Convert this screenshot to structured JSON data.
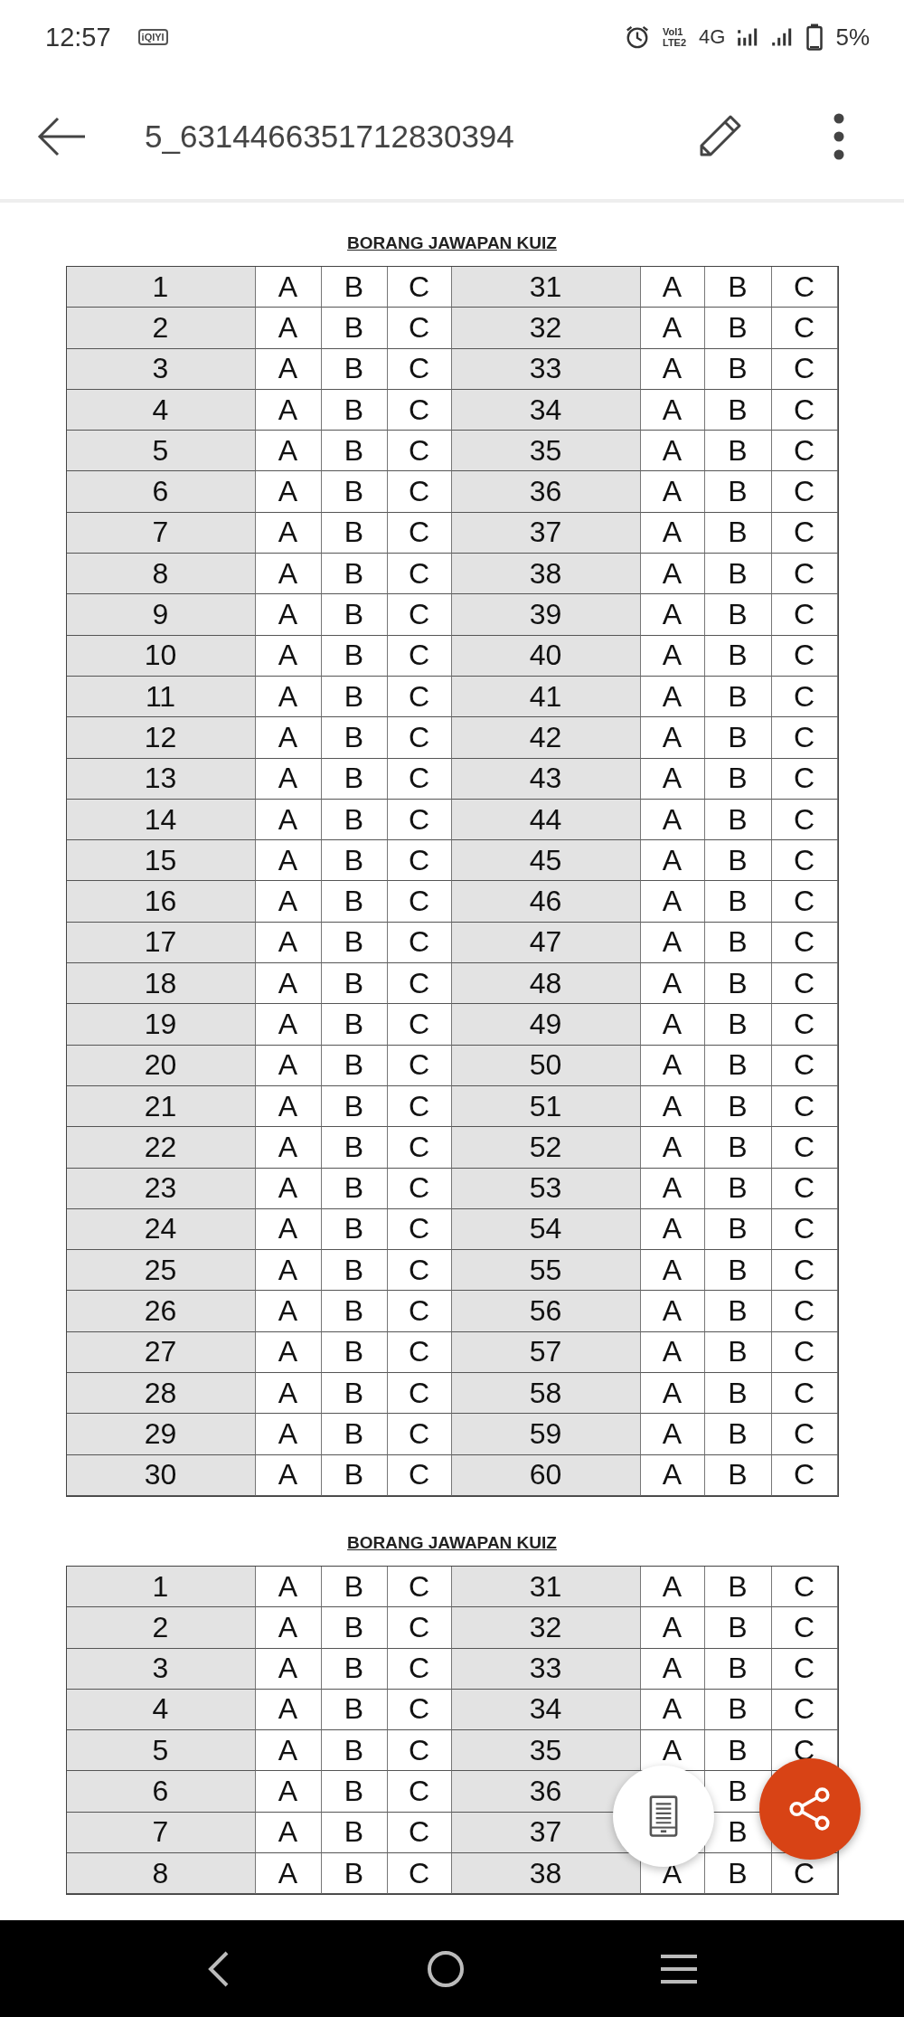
{
  "status_bar": {
    "time": "12:57",
    "app_badge": "iQIYI",
    "volte": [
      "Vol1",
      "LTE2"
    ],
    "network": "4G",
    "battery": "5%"
  },
  "app_bar": {
    "title": "5_6314466351712830394"
  },
  "sheets": [
    {
      "heading": "BORANG JAWAPAN KUIZ",
      "rows": [
        {
          "left": {
            "number": "1",
            "options": [
              "A",
              "B",
              "C"
            ]
          },
          "right": {
            "number": "31",
            "options": [
              "A",
              "B",
              "C"
            ]
          }
        },
        {
          "left": {
            "number": "2",
            "options": [
              "A",
              "B",
              "C"
            ]
          },
          "right": {
            "number": "32",
            "options": [
              "A",
              "B",
              "C"
            ]
          }
        },
        {
          "left": {
            "number": "3",
            "options": [
              "A",
              "B",
              "C"
            ]
          },
          "right": {
            "number": "33",
            "options": [
              "A",
              "B",
              "C"
            ]
          }
        },
        {
          "left": {
            "number": "4",
            "options": [
              "A",
              "B",
              "C"
            ]
          },
          "right": {
            "number": "34",
            "options": [
              "A",
              "B",
              "C"
            ]
          }
        },
        {
          "left": {
            "number": "5",
            "options": [
              "A",
              "B",
              "C"
            ]
          },
          "right": {
            "number": "35",
            "options": [
              "A",
              "B",
              "C"
            ]
          }
        },
        {
          "left": {
            "number": "6",
            "options": [
              "A",
              "B",
              "C"
            ]
          },
          "right": {
            "number": "36",
            "options": [
              "A",
              "B",
              "C"
            ]
          }
        },
        {
          "left": {
            "number": "7",
            "options": [
              "A",
              "B",
              "C"
            ]
          },
          "right": {
            "number": "37",
            "options": [
              "A",
              "B",
              "C"
            ]
          }
        },
        {
          "left": {
            "number": "8",
            "options": [
              "A",
              "B",
              "C"
            ]
          },
          "right": {
            "number": "38",
            "options": [
              "A",
              "B",
              "C"
            ]
          }
        },
        {
          "left": {
            "number": "9",
            "options": [
              "A",
              "B",
              "C"
            ]
          },
          "right": {
            "number": "39",
            "options": [
              "A",
              "B",
              "C"
            ]
          }
        },
        {
          "left": {
            "number": "10",
            "options": [
              "A",
              "B",
              "C"
            ]
          },
          "right": {
            "number": "40",
            "options": [
              "A",
              "B",
              "C"
            ]
          }
        },
        {
          "left": {
            "number": "11",
            "options": [
              "A",
              "B",
              "C"
            ]
          },
          "right": {
            "number": "41",
            "options": [
              "A",
              "B",
              "C"
            ]
          }
        },
        {
          "left": {
            "number": "12",
            "options": [
              "A",
              "B",
              "C"
            ]
          },
          "right": {
            "number": "42",
            "options": [
              "A",
              "B",
              "C"
            ]
          }
        },
        {
          "left": {
            "number": "13",
            "options": [
              "A",
              "B",
              "C"
            ]
          },
          "right": {
            "number": "43",
            "options": [
              "A",
              "B",
              "C"
            ]
          }
        },
        {
          "left": {
            "number": "14",
            "options": [
              "A",
              "B",
              "C"
            ]
          },
          "right": {
            "number": "44",
            "options": [
              "A",
              "B",
              "C"
            ]
          }
        },
        {
          "left": {
            "number": "15",
            "options": [
              "A",
              "B",
              "C"
            ]
          },
          "right": {
            "number": "45",
            "options": [
              "A",
              "B",
              "C"
            ]
          }
        },
        {
          "left": {
            "number": "16",
            "options": [
              "A",
              "B",
              "C"
            ]
          },
          "right": {
            "number": "46",
            "options": [
              "A",
              "B",
              "C"
            ]
          }
        },
        {
          "left": {
            "number": "17",
            "options": [
              "A",
              "B",
              "C"
            ]
          },
          "right": {
            "number": "47",
            "options": [
              "A",
              "B",
              "C"
            ]
          }
        },
        {
          "left": {
            "number": "18",
            "options": [
              "A",
              "B",
              "C"
            ]
          },
          "right": {
            "number": "48",
            "options": [
              "A",
              "B",
              "C"
            ]
          }
        },
        {
          "left": {
            "number": "19",
            "options": [
              "A",
              "B",
              "C"
            ]
          },
          "right": {
            "number": "49",
            "options": [
              "A",
              "B",
              "C"
            ]
          }
        },
        {
          "left": {
            "number": "20",
            "options": [
              "A",
              "B",
              "C"
            ]
          },
          "right": {
            "number": "50",
            "options": [
              "A",
              "B",
              "C"
            ]
          }
        },
        {
          "left": {
            "number": "21",
            "options": [
              "A",
              "B",
              "C"
            ]
          },
          "right": {
            "number": "51",
            "options": [
              "A",
              "B",
              "C"
            ]
          }
        },
        {
          "left": {
            "number": "22",
            "options": [
              "A",
              "B",
              "C"
            ]
          },
          "right": {
            "number": "52",
            "options": [
              "A",
              "B",
              "C"
            ]
          }
        },
        {
          "left": {
            "number": "23",
            "options": [
              "A",
              "B",
              "C"
            ]
          },
          "right": {
            "number": "53",
            "options": [
              "A",
              "B",
              "C"
            ]
          }
        },
        {
          "left": {
            "number": "24",
            "options": [
              "A",
              "B",
              "C"
            ]
          },
          "right": {
            "number": "54",
            "options": [
              "A",
              "B",
              "C"
            ]
          }
        },
        {
          "left": {
            "number": "25",
            "options": [
              "A",
              "B",
              "C"
            ]
          },
          "right": {
            "number": "55",
            "options": [
              "A",
              "B",
              "C"
            ]
          }
        },
        {
          "left": {
            "number": "26",
            "options": [
              "A",
              "B",
              "C"
            ]
          },
          "right": {
            "number": "56",
            "options": [
              "A",
              "B",
              "C"
            ]
          }
        },
        {
          "left": {
            "number": "27",
            "options": [
              "A",
              "B",
              "C"
            ]
          },
          "right": {
            "number": "57",
            "options": [
              "A",
              "B",
              "C"
            ]
          }
        },
        {
          "left": {
            "number": "28",
            "options": [
              "A",
              "B",
              "C"
            ]
          },
          "right": {
            "number": "58",
            "options": [
              "A",
              "B",
              "C"
            ]
          }
        },
        {
          "left": {
            "number": "29",
            "options": [
              "A",
              "B",
              "C"
            ]
          },
          "right": {
            "number": "59",
            "options": [
              "A",
              "B",
              "C"
            ]
          }
        },
        {
          "left": {
            "number": "30",
            "options": [
              "A",
              "B",
              "C"
            ]
          },
          "right": {
            "number": "60",
            "options": [
              "A",
              "B",
              "C"
            ]
          }
        }
      ]
    },
    {
      "heading": "BORANG JAWAPAN KUIZ",
      "rows": [
        {
          "left": {
            "number": "1",
            "options": [
              "A",
              "B",
              "C"
            ]
          },
          "right": {
            "number": "31",
            "options": [
              "A",
              "B",
              "C"
            ]
          }
        },
        {
          "left": {
            "number": "2",
            "options": [
              "A",
              "B",
              "C"
            ]
          },
          "right": {
            "number": "32",
            "options": [
              "A",
              "B",
              "C"
            ]
          }
        },
        {
          "left": {
            "number": "3",
            "options": [
              "A",
              "B",
              "C"
            ]
          },
          "right": {
            "number": "33",
            "options": [
              "A",
              "B",
              "C"
            ]
          }
        },
        {
          "left": {
            "number": "4",
            "options": [
              "A",
              "B",
              "C"
            ]
          },
          "right": {
            "number": "34",
            "options": [
              "A",
              "B",
              "C"
            ]
          }
        },
        {
          "left": {
            "number": "5",
            "options": [
              "A",
              "B",
              "C"
            ]
          },
          "right": {
            "number": "35",
            "options": [
              "A",
              "B",
              "C"
            ]
          }
        },
        {
          "left": {
            "number": "6",
            "options": [
              "A",
              "B",
              "C"
            ]
          },
          "right": {
            "number": "36",
            "options": [
              {
                "kind": "covered"
              },
              {
                "kind": "letter",
                "text": "B"
              },
              {
                "kind": "covered"
              }
            ]
          }
        },
        {
          "left": {
            "number": "7",
            "options": [
              "A",
              "B",
              "C"
            ]
          },
          "right": {
            "number": "37",
            "options": [
              {
                "kind": "covered"
              },
              {
                "kind": "letter",
                "text": "B"
              },
              {
                "kind": "covered"
              }
            ]
          }
        },
        {
          "left": {
            "number": "8",
            "options": [
              "A",
              "B",
              "C"
            ]
          },
          "right": {
            "number": "38",
            "options": [
              "A",
              "B",
              "C"
            ]
          }
        }
      ]
    }
  ]
}
